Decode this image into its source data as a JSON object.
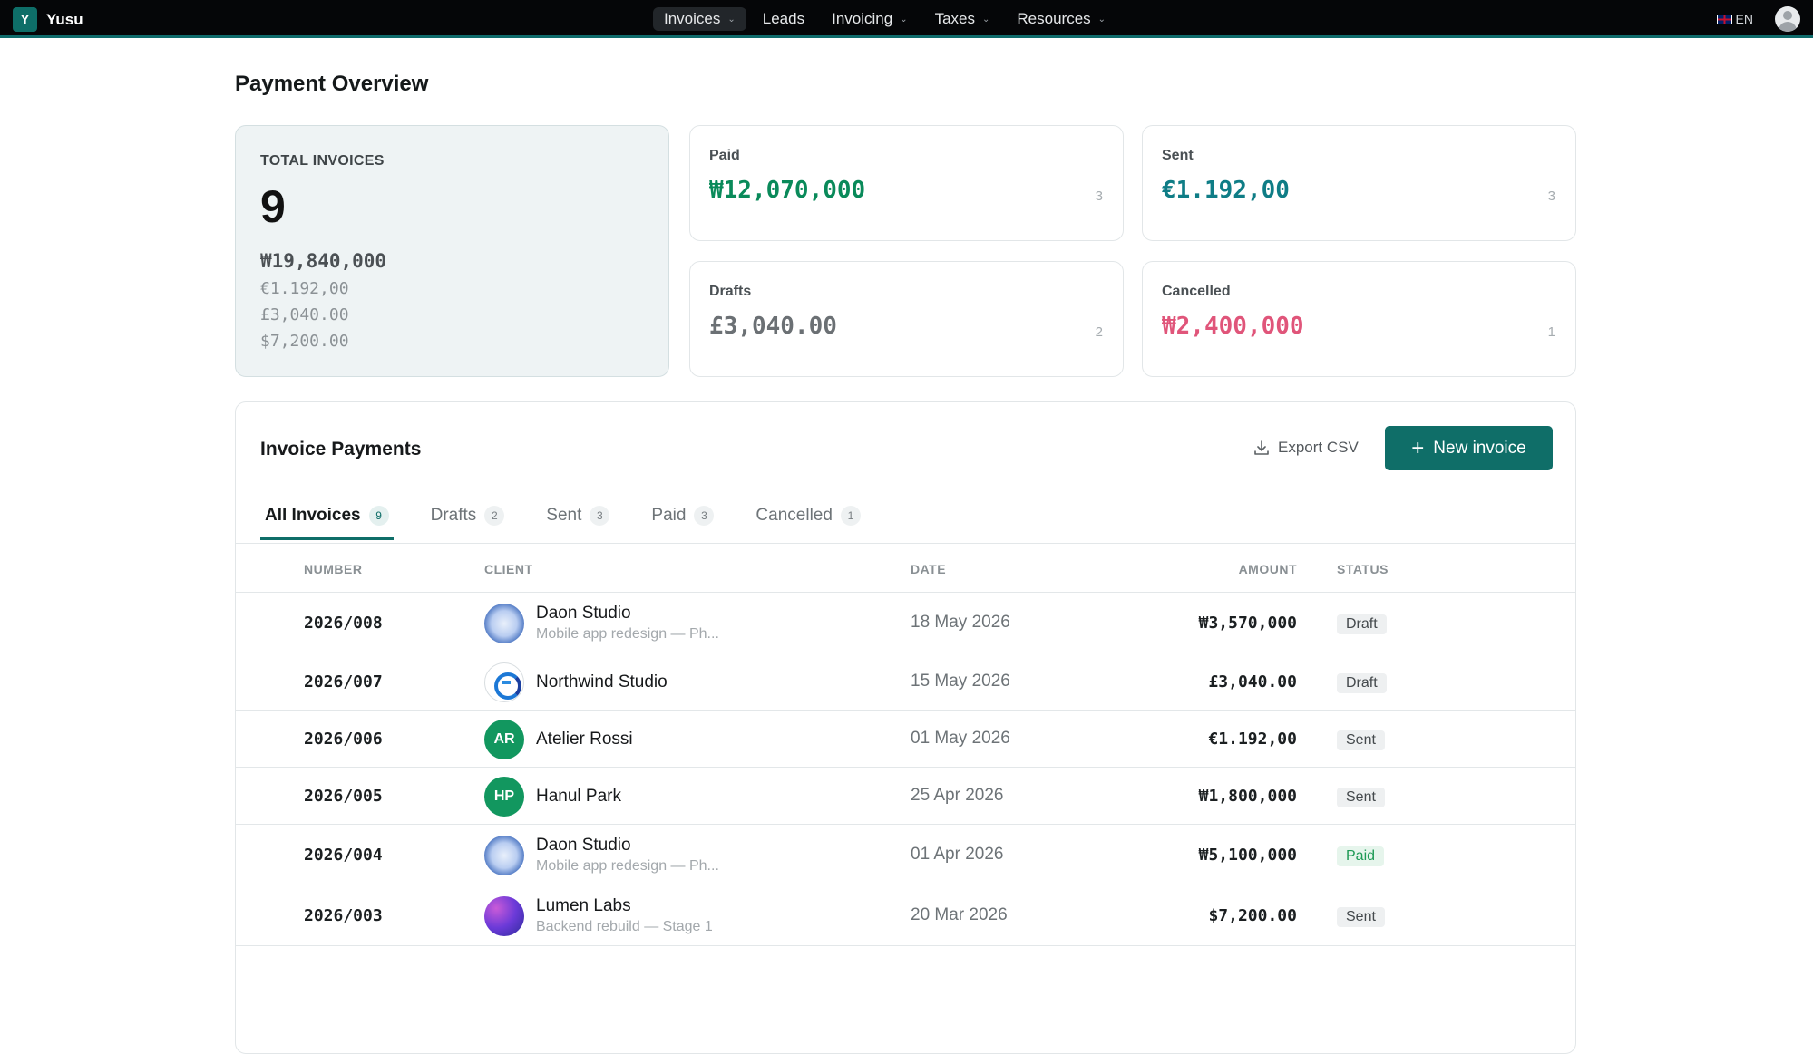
{
  "colors": {
    "accent": "#0f6e68",
    "paid": "#0a8a5a",
    "sent": "#0f7d86",
    "drafts": "#6b7074",
    "cancelled": "#e0557a"
  },
  "nav": {
    "brand_letter": "Y",
    "brand_name": "Yusu",
    "items": [
      {
        "label": "Invoices",
        "has_caret": true,
        "active": true
      },
      {
        "label": "Leads",
        "has_caret": false,
        "active": false
      },
      {
        "label": "Invoicing",
        "has_caret": true,
        "active": false
      },
      {
        "label": "Taxes",
        "has_caret": true,
        "active": false
      },
      {
        "label": "Resources",
        "has_caret": true,
        "active": false
      }
    ],
    "language": "EN"
  },
  "page": {
    "title": "Payment Overview"
  },
  "overview": {
    "total": {
      "label": "TOTAL INVOICES",
      "count": "9",
      "amounts": [
        "₩19,840,000",
        "€1.192,00",
        "£3,040.00",
        "$7,200.00"
      ]
    },
    "paid": {
      "label": "Paid",
      "amount": "₩12,070,000",
      "count": "3"
    },
    "sent": {
      "label": "Sent",
      "amount": "€1.192,00",
      "count": "3"
    },
    "drafts": {
      "label": "Drafts",
      "amount": "£3,040.00",
      "count": "2"
    },
    "cancelled": {
      "label": "Cancelled",
      "amount": "₩2,400,000",
      "count": "1"
    }
  },
  "invoices": {
    "title": "Invoice Payments",
    "export_label": "Export CSV",
    "new_label": "New invoice",
    "tabs": [
      {
        "label": "All Invoices",
        "count": "9",
        "active": true
      },
      {
        "label": "Drafts",
        "count": "2",
        "active": false
      },
      {
        "label": "Sent",
        "count": "3",
        "active": false
      },
      {
        "label": "Paid",
        "count": "3",
        "active": false
      },
      {
        "label": "Cancelled",
        "count": "1",
        "active": false
      }
    ],
    "columns": {
      "number": "NUMBER",
      "client": "CLIENT",
      "date": "DATE",
      "amount": "AMOUNT",
      "status": "STATUS"
    },
    "rows": [
      {
        "number": "2026/008",
        "client": "Daon Studio",
        "sub": "Mobile app redesign — Ph...",
        "avatar": "globe",
        "initials": "",
        "date": "18 May 2026",
        "amount": "₩3,570,000",
        "status": "Draft",
        "status_tone": "gray"
      },
      {
        "number": "2026/007",
        "client": "Northwind Studio",
        "sub": "",
        "avatar": "ring",
        "initials": "",
        "date": "15 May 2026",
        "amount": "£3,040.00",
        "status": "Draft",
        "status_tone": "gray"
      },
      {
        "number": "2026/006",
        "client": "Atelier Rossi",
        "sub": "",
        "avatar": "green",
        "initials": "AR",
        "date": "01 May 2026",
        "amount": "€1.192,00",
        "status": "Sent",
        "status_tone": "gray"
      },
      {
        "number": "2026/005",
        "client": "Hanul Park",
        "sub": "",
        "avatar": "green",
        "initials": "HP",
        "date": "25 Apr 2026",
        "amount": "₩1,800,000",
        "status": "Sent",
        "status_tone": "gray"
      },
      {
        "number": "2026/004",
        "client": "Daon Studio",
        "sub": "Mobile app redesign — Ph...",
        "avatar": "globe",
        "initials": "",
        "date": "01 Apr 2026",
        "amount": "₩5,100,000",
        "status": "Paid",
        "status_tone": "green"
      },
      {
        "number": "2026/003",
        "client": "Lumen Labs",
        "sub": "Backend rebuild — Stage 1",
        "avatar": "purple",
        "initials": "",
        "date": "20 Mar 2026",
        "amount": "$7,200.00",
        "status": "Sent",
        "status_tone": "gray"
      }
    ]
  }
}
